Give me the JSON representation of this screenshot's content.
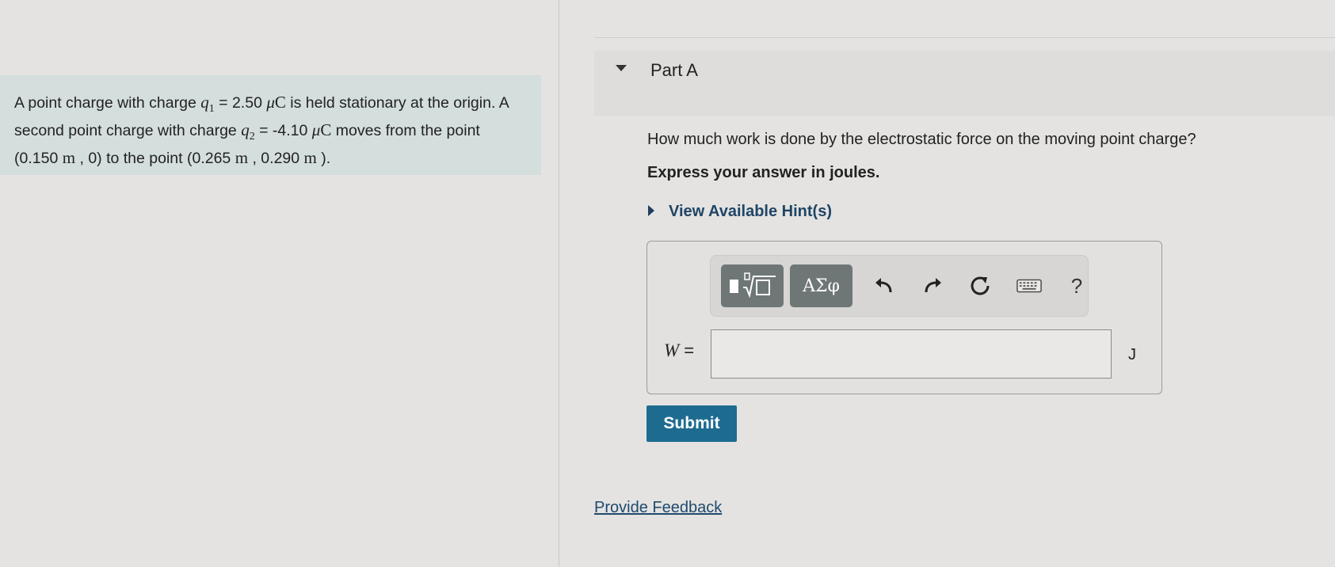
{
  "problem": {
    "seg1": "A point charge with charge ",
    "q1_symbol": "q",
    "q1_sub": "1",
    "q1_value": " = 2.50 ",
    "q1_unit_mu": "μ",
    "q1_unit_c": "C",
    "seg2": " is held stationary at the origin. A second point charge with charge ",
    "q2_symbol": "q",
    "q2_sub": "2",
    "q2_value": " = -4.10 ",
    "q2_unit_mu": "μ",
    "q2_unit_c": "C",
    "seg3": " moves from the point (0.150 ",
    "m1": "m",
    "seg4": " , 0) to the point (0.265 ",
    "m2": "m",
    "seg5": " , 0.290 ",
    "m3": "m",
    "seg6": " )."
  },
  "part": {
    "title": "Part A",
    "question": "How much work is done by the electrostatic force on the moving point charge?",
    "instruction": "Express your answer in joules.",
    "hint_label": "View Available Hint(s)"
  },
  "toolbar": {
    "greek_label": "ΑΣφ",
    "help_label": "?",
    "icons": [
      "templates-icon",
      "undo-icon",
      "redo-icon",
      "reset-icon",
      "keyboard-icon",
      "help-icon"
    ]
  },
  "answer": {
    "variable": "W",
    "equals": " =",
    "value": "",
    "unit": "J"
  },
  "submit_label": "Submit",
  "feedback_label": "Provide Feedback",
  "colors": {
    "submit_bg": "#1d6b8f",
    "problem_bg": "#d4dedd",
    "link": "#1f4a6e"
  }
}
